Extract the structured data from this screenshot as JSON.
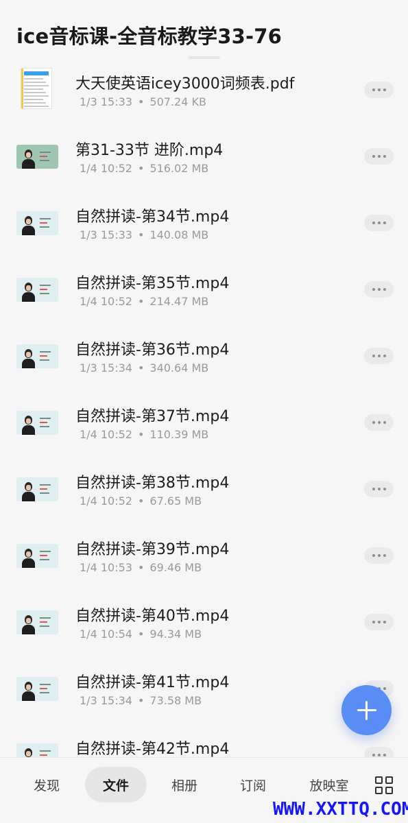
{
  "header": {
    "title": "ice音标课-全音标教学33-76"
  },
  "files": [
    {
      "name": "大天使英语icey3000词频表.pdf",
      "date": "1/3 15:33",
      "size": "507.24 KB",
      "type": "pdf"
    },
    {
      "name": "第31-33节 进阶.mp4",
      "date": "1/4 10:52",
      "size": "516.02 MB",
      "type": "video"
    },
    {
      "name": "自然拼读-第34节.mp4",
      "date": "1/3 15:33",
      "size": "140.08 MB",
      "type": "video"
    },
    {
      "name": "自然拼读-第35节.mp4",
      "date": "1/4 10:52",
      "size": "214.47 MB",
      "type": "video"
    },
    {
      "name": "自然拼读-第36节.mp4",
      "date": "1/3 15:34",
      "size": "340.64 MB",
      "type": "video"
    },
    {
      "name": "自然拼读-第37节.mp4",
      "date": "1/4 10:52",
      "size": "110.39 MB",
      "type": "video"
    },
    {
      "name": "自然拼读-第38节.mp4",
      "date": "1/4 10:52",
      "size": "67.65 MB",
      "type": "video"
    },
    {
      "name": "自然拼读-第39节.mp4",
      "date": "1/4 10:53",
      "size": "69.46 MB",
      "type": "video"
    },
    {
      "name": "自然拼读-第40节.mp4",
      "date": "1/4 10:54",
      "size": "94.34 MB",
      "type": "video"
    },
    {
      "name": "自然拼读-第41节.mp4",
      "date": "1/3 15:34",
      "size": "73.58 MB",
      "type": "video"
    },
    {
      "name": "自然拼读-第42节.mp4",
      "date": "",
      "size": "",
      "type": "video"
    }
  ],
  "meta_separator": "•",
  "nav": {
    "discover": "发现",
    "files": "文件",
    "album": "相册",
    "subscribe": "订阅",
    "theater": "放映室"
  },
  "watermark": "WWW.XXTTQ.COM",
  "colors": {
    "accent": "#5b8df7",
    "background": "#f6f6f6",
    "watermark": "#1515ff"
  }
}
